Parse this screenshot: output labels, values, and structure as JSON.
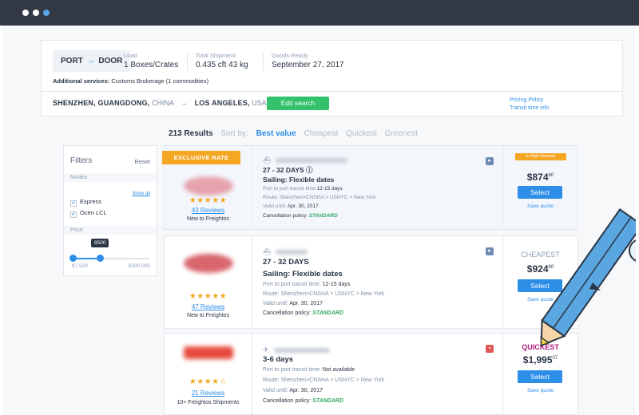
{
  "window": {
    "controls": [
      "close",
      "minimize",
      "maximize"
    ]
  },
  "summary": {
    "mode_from": "PORT",
    "mode_to": "DOOR",
    "load_label": "Load",
    "load_value": "1 Boxes/Crates",
    "total_label": "Total Shipment",
    "total_value": "0.435 cft 43 kg",
    "ready_label": "Goods Ready",
    "ready_value": "September 27, 2017",
    "additional_label": "Additional services:",
    "additional_value": "Customs Brokerage (1 commodities)",
    "origin_city": "SHENZHEN, GUANGDONG,",
    "origin_country": "CHINA",
    "dest_city": "LOS ANGELES,",
    "dest_country": "USA",
    "edit_label": "Edit search",
    "pricing_policy": "Pricing Policy",
    "transit_info": "Transit time info"
  },
  "results": {
    "count": "213 Results",
    "sort_label": "Sort by:",
    "sort_options": [
      "Best value",
      "Cheapest",
      "Quickest",
      "Greenest"
    ],
    "active_sort": "Best value"
  },
  "filters": {
    "title": "Filters",
    "reset": "Reset",
    "modes_label": "Modes",
    "show_all": "Show all",
    "modes": [
      {
        "label": "Express",
        "checked": true
      },
      {
        "label": "Ocen LCL",
        "checked": true
      }
    ],
    "price_label": "Price",
    "price_tooltip": "9500",
    "price_min": "$7,500",
    "price_max": "$200,000",
    "price_fill": 0.35
  },
  "cards": [
    {
      "badge": "EXCLUSIVE RATE",
      "stars": "★★★★★",
      "reviews": "43 Reviews",
      "vendor_status": "New to Freightos",
      "days": "27 - 32 DAYS ⓘ",
      "sailing": "Sailing: Flexible dates",
      "transit": "Port to port transit time:",
      "transit_val": "12-15 days",
      "route": "Route: Shenzhen>CNSHA > USNYC > New York",
      "valid": "Valid until:",
      "valid_val": "Apr. 30, 2017",
      "cancel": "Cancellation policy:",
      "cancel_val": "STANDARD",
      "tag": "In High Demand",
      "price_main": "$874",
      "price_cents": "60",
      "select": "Select",
      "save": "Save quote",
      "logo_color": "#e6a3ad",
      "corner_color": "#6f8bb3"
    },
    {
      "stars": "★★★★★",
      "reviews": "47 Reviews",
      "vendor_status": "New to Freightos",
      "days": "27 - 32 DAYS",
      "sailing": "Sailing: Flexible dates",
      "transit": "Port to port transit time:",
      "transit_val": "12-15 days",
      "route": "Route: Shenzhen>CNSHA > USNYC > New York",
      "valid": "Valid until:",
      "valid_val": "Apr. 30, 2017",
      "cancel": "Cancellation policy:",
      "cancel_val": "STANDARD",
      "tag": "CHEAPEST",
      "tag_color": "#8fa0b4",
      "price_main": "$924",
      "price_cents": "60",
      "select": "Select",
      "save": "Save quote",
      "logo_color": "#d9666f",
      "corner_color": "#6f8bb3"
    },
    {
      "stars": "★★★★☆",
      "reviews": "21 Reviews",
      "vendor_status": "10+ Freightos Shipments",
      "days": "3-6 days",
      "transit": "Port to port transit time:",
      "transit_val": "Not available",
      "route": "Route: Shenzhen>CNSHA > USNYC > New York",
      "valid": "Valid until:",
      "valid_val": "Apr. 30, 2017",
      "cancel": "Cancellation policy:",
      "cancel_val": "STANDARD",
      "tag": "QUICKEST",
      "tag_color": "#b0177e",
      "price_main": "$1,995",
      "price_cents": "07",
      "select": "Select",
      "save": "Save quote",
      "logo_color": "#e84a3e",
      "corner_color": "#e05555"
    }
  ]
}
